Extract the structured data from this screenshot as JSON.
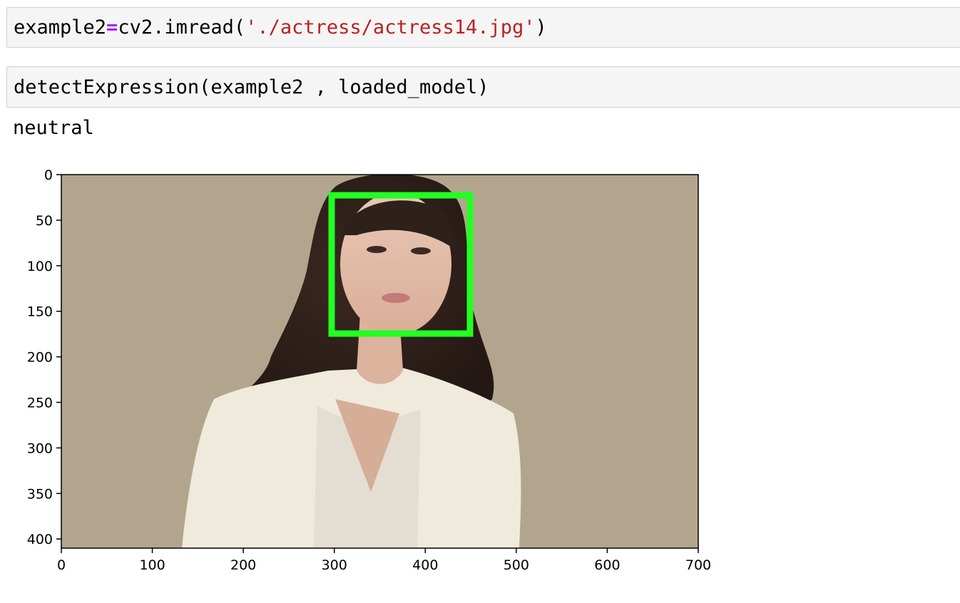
{
  "cells": [
    {
      "tokens": {
        "var": "example2",
        "op": "=",
        "call": "cv2.imread(",
        "str": "'./actress/actress14.jpg'",
        "close": ")"
      }
    },
    {
      "code": "detectExpression(example2 , loaded_model)",
      "output": "neutral"
    }
  ],
  "plot": {
    "x_ticks": [
      "0",
      "100",
      "200",
      "300",
      "400",
      "500",
      "600",
      "700"
    ],
    "y_ticks": [
      "0",
      "50",
      "100",
      "150",
      "200",
      "250",
      "300",
      "350",
      "400"
    ],
    "xlim": [
      0,
      700
    ],
    "ylim_inverted": [
      410,
      0
    ],
    "image_background": "#b3a58d",
    "face_box_color": "#22ff22",
    "face_box": {
      "x": [
        298,
        450
      ],
      "y": [
        22,
        174
      ]
    }
  }
}
